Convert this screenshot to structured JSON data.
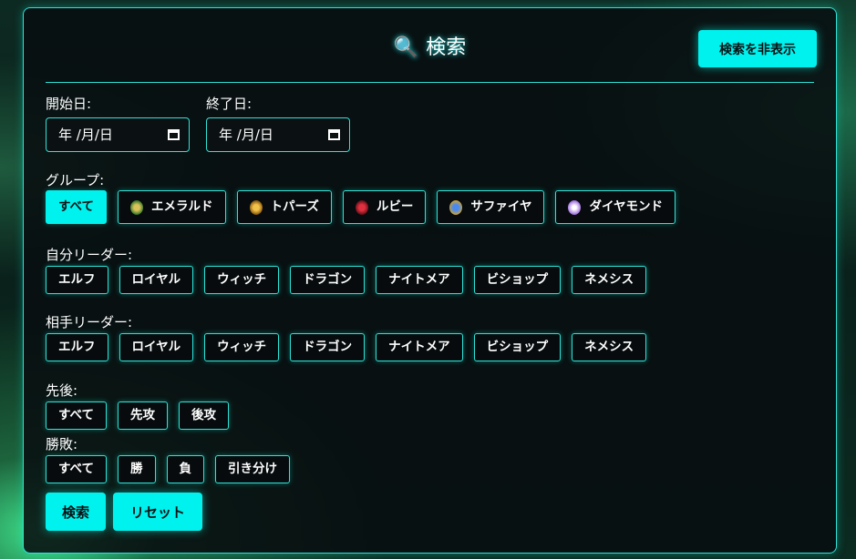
{
  "header": {
    "icon": "search-icon",
    "title": "検索",
    "hide_label": "検索を非表示"
  },
  "dates": {
    "start_label": "開始日:",
    "end_label": "終了日:",
    "start_value": "年 /月/日",
    "end_value": "年 /月/日"
  },
  "groups": {
    "label": "グループ:",
    "items": [
      {
        "label": "すべて",
        "active": true
      },
      {
        "label": "エメラルド",
        "icon": "emerald-icon"
      },
      {
        "label": "トパーズ",
        "icon": "topaz-icon"
      },
      {
        "label": "ルビー",
        "icon": "ruby-icon"
      },
      {
        "label": "サファイヤ",
        "icon": "sapphire-icon"
      },
      {
        "label": "ダイヤモンド",
        "icon": "diamond-icon"
      }
    ]
  },
  "self_leader": {
    "label": "自分リーダー:",
    "items": [
      "エルフ",
      "ロイヤル",
      "ウィッチ",
      "ドラゴン",
      "ナイトメア",
      "ビショップ",
      "ネメシス"
    ]
  },
  "opp_leader": {
    "label": "相手リーダー:",
    "items": [
      "エルフ",
      "ロイヤル",
      "ウィッチ",
      "ドラゴン",
      "ナイトメア",
      "ビショップ",
      "ネメシス"
    ]
  },
  "turn": {
    "label": "先後:",
    "items": [
      "すべて",
      "先攻",
      "後攻"
    ]
  },
  "result": {
    "label": "勝敗:",
    "items": [
      "すべて",
      "勝",
      "負",
      "引き分け"
    ]
  },
  "actions": {
    "search": "検索",
    "reset": "リセット"
  },
  "colors": {
    "accent": "#00f2ee",
    "panel_bg": "#080e10",
    "border": "#2fe3d8"
  }
}
